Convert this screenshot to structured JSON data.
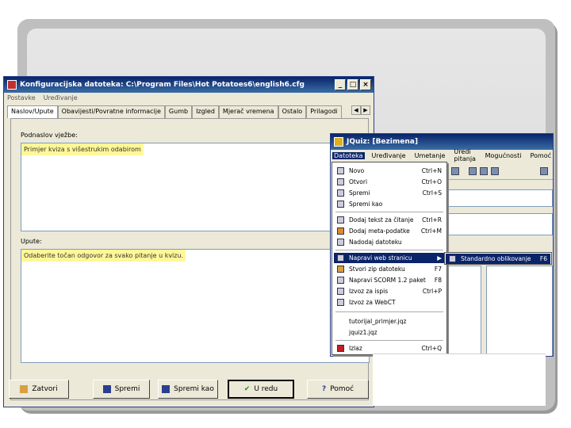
{
  "config_window": {
    "title": "Konfiguracijska datoteka: C:\\Program Files\\Hot Potatoes6\\english6.cfg",
    "menu": [
      "Postavke",
      "Uređivanje"
    ],
    "tabs": [
      "Naslov/Upute",
      "Obavijesti/Povratne informacije",
      "Gumb",
      "Izgled",
      "Mjerač vremena",
      "Ostalo",
      "Prilagodi"
    ],
    "active_tab": "Naslov/Upute",
    "subtitle_label": "Podnaslov vježbe:",
    "subtitle_value": "Primjer kviza s višestrukim odabirom",
    "instructions_label": "Upute:",
    "instructions_value": "Odaberite točan odgovor za svako pitanje u kvizu.",
    "buttons": {
      "close": "Zatvori",
      "save": "Spremi",
      "save_as": "Spremi kao",
      "ok": "U redu",
      "help": "Pomoć"
    }
  },
  "jquiz_window": {
    "title": "JQuiz: [Bezimena]",
    "menu": [
      "Datoteka",
      "Uređivanje",
      "Umetanje",
      "Uredi pitanja",
      "Mogućnosti",
      "Pomoć"
    ],
    "open_menu": "Datoteka",
    "file_menu": [
      {
        "label": "Novo",
        "shortcut": "Ctrl+N",
        "icon": "new-icon"
      },
      {
        "label": "Otvori",
        "shortcut": "Ctrl+O",
        "icon": "open-icon"
      },
      {
        "label": "Spremi",
        "shortcut": "Ctrl+S",
        "icon": "save-icon"
      },
      {
        "label": "Spremi kao",
        "shortcut": "",
        "icon": "save-as-icon"
      },
      {
        "label": "Dodaj tekst za čitanje",
        "shortcut": "Ctrl+R",
        "icon": "reading-icon"
      },
      {
        "label": "Dodaj meta-podatke",
        "shortcut": "Ctrl+M",
        "icon": "metadata-icon"
      },
      {
        "label": "Nadodaj datoteku",
        "shortcut": "",
        "icon": "plus-icon"
      },
      {
        "label": "Napravi web stranicu",
        "shortcut": "",
        "icon": "web-icon",
        "submenu": true
      },
      {
        "label": "Stvori zip datoteku",
        "shortcut": "F7",
        "icon": "zip-icon"
      },
      {
        "label": "Napravi SCORM 1.2 paket",
        "shortcut": "F8",
        "icon": "scorm-icon"
      },
      {
        "label": "Izvoz za ispis",
        "shortcut": "Ctrl+P",
        "icon": "print-icon"
      },
      {
        "label": "Izvoz za WebCT",
        "shortcut": "",
        "icon": "webct-icon"
      },
      {
        "label": "tutorijal_primjer.jqz",
        "shortcut": "",
        "icon": ""
      },
      {
        "label": "jquiz1.jqz",
        "shortcut": "",
        "icon": ""
      },
      {
        "label": "Izlaz",
        "shortcut": "Ctrl+Q",
        "icon": "exit-icon"
      }
    ],
    "submenu_item": {
      "label": "Standardno oblikovanje",
      "shortcut": "F6"
    }
  }
}
